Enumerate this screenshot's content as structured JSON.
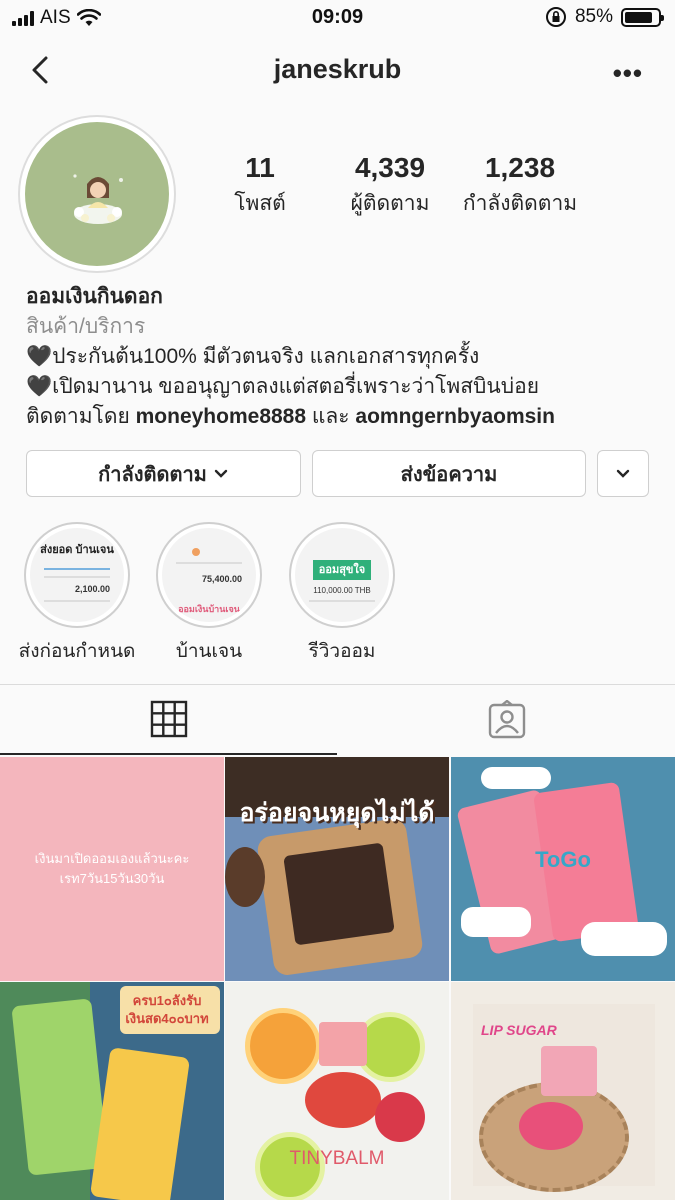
{
  "status": {
    "carrier": "AIS",
    "time": "09:09",
    "battery": "85%",
    "battery_level": 0.85
  },
  "header": {
    "username": "janeskrub"
  },
  "profile": {
    "stats": [
      {
        "value": "11",
        "label": "โพสต์"
      },
      {
        "value": "4,339",
        "label": "ผู้ติดตาม"
      },
      {
        "value": "1,238",
        "label": "กำลังติดตาม"
      }
    ],
    "name": "ออมเงินกินดอก",
    "category": "สินค้า/บริการ",
    "bio_line1": "🖤ประกันต้น100% มีตัวตนจริง แลกเอกสารทุกครั้ง",
    "bio_line2": "🖤เปิดมานาน ขออนุญาตลงแต่สตอรี่เพราะว่าโพสบินบ่อย",
    "followed_prefix": "ติดตามโดย",
    "followed_user1": "moneyhome8888",
    "followed_and": "และ",
    "followed_user2": "aomngernbyaomsin"
  },
  "buttons": {
    "following": "กำลังติดตาม",
    "message": "ส่งข้อความ"
  },
  "highlights": [
    {
      "label": "ส่งก่อนกำหนด",
      "thumb_title": "ส่งยอด บ้านเจน",
      "thumb_amount": "2,100.00"
    },
    {
      "label": "บ้านเจน",
      "thumb_title": "ออมเงินบ้านเจน",
      "thumb_amount": "75,400.00"
    },
    {
      "label": "รีวิวออม",
      "thumb_title": "ออมสุขใจ",
      "thumb_amount": "110,000.00 THB"
    }
  ],
  "posts": [
    {
      "caption": "เงินมาเปิดออมเองแล้วนะคะ\nเรท7วัน15วัน30วัน"
    },
    {
      "caption": "อร่อยจนหยุดไม่ได้"
    },
    {
      "caption": "ToGo"
    },
    {
      "caption": "ครบ1๐ลังรับ เงินสด4๐๐บาท"
    },
    {
      "caption": "TINYBALM"
    },
    {
      "caption": "LIP SUGAR"
    }
  ],
  "colors": {
    "avatar_bg": "#a9bd8c",
    "post1_bg": "#f4b6bd",
    "post2_bg": "#7c5a44",
    "post3_bg": "#4f8fae",
    "post4_bg": "#3c6a8a",
    "post5_bg": "#f2f2ee",
    "post6_bg": "#f1ece4"
  }
}
